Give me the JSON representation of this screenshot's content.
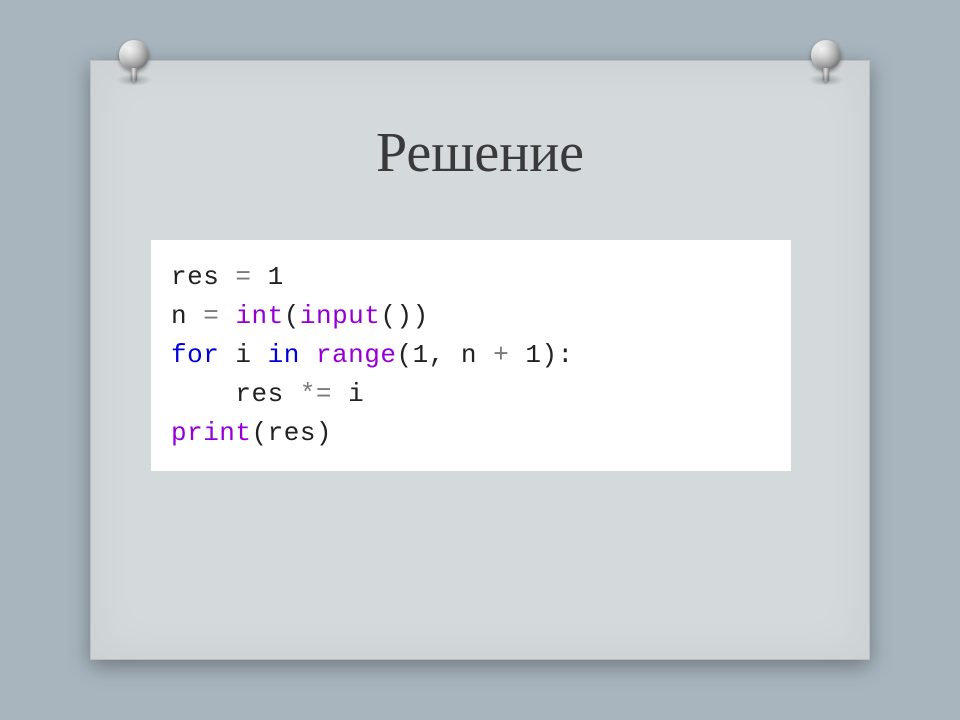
{
  "title": "Решение",
  "code": {
    "line1": {
      "t1": "res ",
      "t2": "= ",
      "t3": "1"
    },
    "line2": {
      "t1": "n ",
      "t2": "= ",
      "t3": "int",
      "t4": "(",
      "t5": "input",
      "t6": "())"
    },
    "line3": {
      "t1": "for ",
      "t2": "i ",
      "t3": "in ",
      "t4": "range",
      "t5": "(",
      "t6": "1",
      "t7": ", n ",
      "t8": "+ ",
      "t9": "1",
      "t10": "):"
    },
    "line4": {
      "t1": "    res ",
      "t2": "*= ",
      "t3": "i"
    },
    "line5": {
      "t1": "print",
      "t2": "(res)"
    }
  }
}
